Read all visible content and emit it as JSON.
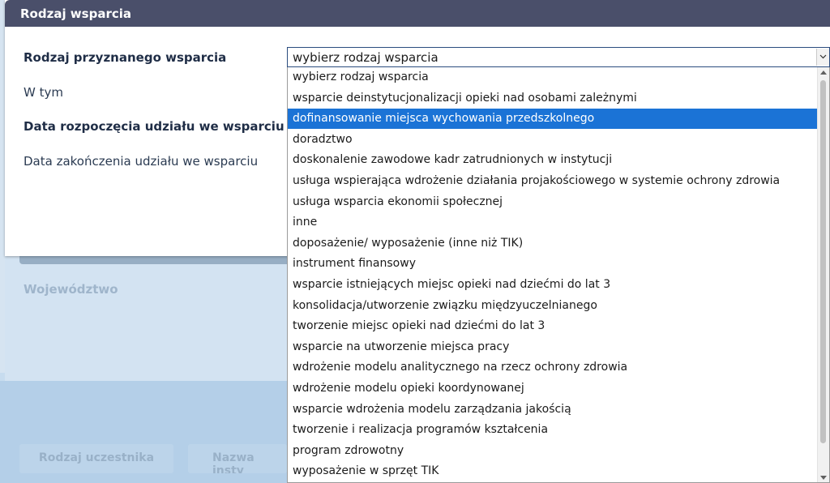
{
  "modal": {
    "title": "Rodzaj wsparcia",
    "fields": {
      "support_type_label": "Rodzaj przyznanego wsparcia",
      "in_that_label": "W tym",
      "start_date_label": "Data rozpoczęcia udziału we wsparciu",
      "end_date_label": "Data zakończenia udziału we wsparciu"
    },
    "select": {
      "value": "wybierz rodzaj wsparcia",
      "selected_index": 2,
      "options": [
        "wybierz rodzaj wsparcia",
        "wsparcie deinstytucjonalizacji opieki nad osobami zależnymi",
        "dofinansowanie miejsca wychowania przedszkolnego",
        "doradztwo",
        "doskonalenie zawodowe kadr zatrudnionych w instytucji",
        "usługa wspierająca wdrożenie działania projakościowego w systemie ochrony zdrowia",
        "usługa wsparcia ekonomii społecznej",
        "inne",
        "doposażenie/ wyposażenie (inne niż TIK)",
        "instrument finansowy",
        "wsparcie istniejących miejsc opieki nad dziećmi do lat 3",
        "konsolidacja/utworzenie związku międzyuczelnianego",
        "tworzenie miejsc opieki nad dziećmi do lat 3",
        "wsparcie na utworzenie miejsca pracy",
        "wdrożenie modelu analitycznego na rzecz ochrony zdrowia",
        "wdrożenie modelu opieki koordynowanej",
        "wsparcie wdrożenia modelu zarządzania jakością",
        "tworzenie i realizacja programów kształcenia",
        "program zdrowotny",
        "wyposażenie w sprzęt TIK"
      ]
    }
  },
  "background": {
    "voivodeship_label": "Województwo",
    "columns": [
      "Rodzaj uczestnika",
      "Nazwa insty"
    ]
  },
  "colors": {
    "header_bg": "#4a4f6a",
    "selected_option_bg": "#1b73d6",
    "overlay": "#c7dcef"
  }
}
